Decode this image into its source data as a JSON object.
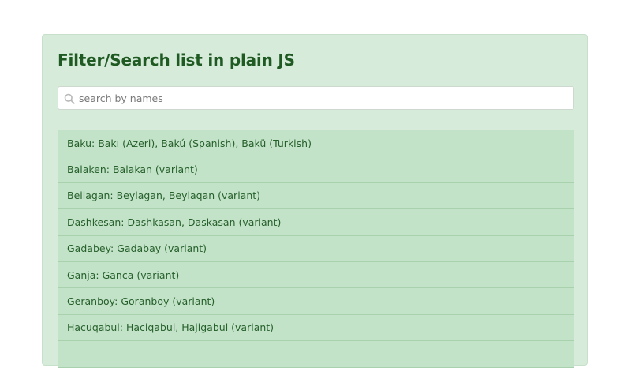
{
  "page": {
    "title": "Filter/Search list in plain JS"
  },
  "search": {
    "placeholder": "search by names",
    "value": "",
    "icon": "search-icon"
  },
  "colors": {
    "card_background": "#d6ebd9",
    "title": "#1f5a23",
    "item_background": "#c3e3c8",
    "item_text": "#255f2a"
  },
  "items": [
    {
      "label": "Baku: Bakı (Azeri), Bakú (Spanish), Bakü (Turkish)"
    },
    {
      "label": "Balaken: Balakan (variant)"
    },
    {
      "label": "Beilagan: Beylagan, Beylaqan (variant)"
    },
    {
      "label": "Dashkesan: Dashkasan, Daskasan (variant)"
    },
    {
      "label": "Gadabey: Gadabay (variant)"
    },
    {
      "label": "Ganja: Ganca (variant)"
    },
    {
      "label": "Geranboy: Goranboy (variant)"
    },
    {
      "label": "Hacuqabul: Haciqabul, Hajigabul (variant)"
    },
    {
      "label": ""
    }
  ]
}
